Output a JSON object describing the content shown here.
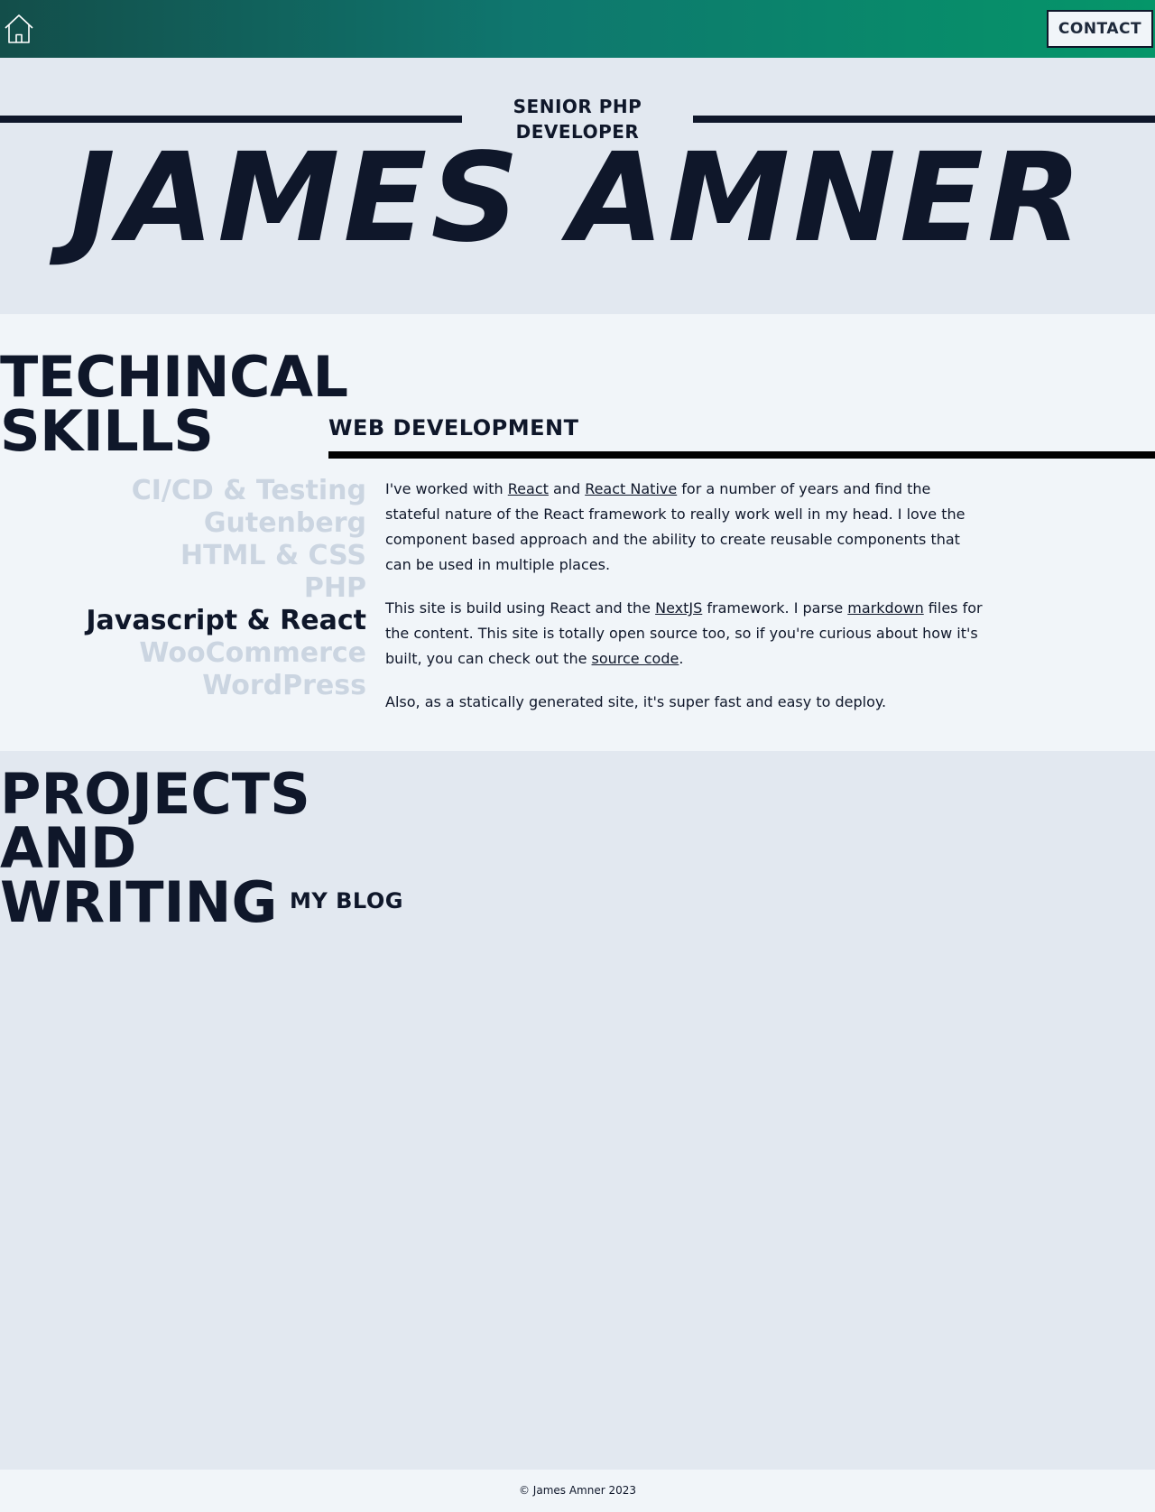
{
  "header": {
    "home_icon": "home-icon",
    "contact_label": "CONTACT",
    "gradient_colors": [
      "#134e4a",
      "#059669"
    ]
  },
  "hero": {
    "subtitle_line1": "SENIOR PHP",
    "subtitle_line2": "DEVELOPER",
    "name": "JAMES AMNER"
  },
  "skills": {
    "title_line1": "TECHINCAL",
    "title_line2": "SKILLS",
    "active_heading": "WEB DEVELOPMENT",
    "items": [
      {
        "label": "CI/CD & Testing",
        "active": false
      },
      {
        "label": "Gutenberg",
        "active": false
      },
      {
        "label": "HTML & CSS",
        "active": false
      },
      {
        "label": "PHP",
        "active": false
      },
      {
        "label": "Javascript & React",
        "active": true
      },
      {
        "label": "WooCommerce",
        "active": false
      },
      {
        "label": "WordPress",
        "active": false
      }
    ],
    "paragraph1": {
      "t1": "I've worked with ",
      "link1": "React",
      "t2": " and ",
      "link2": "React Native",
      "t3": " for a number of years and find the stateful nature of the React framework to really work well in my head. I love the component based approach and the ability to create reusable components that can be used in multiple places."
    },
    "paragraph2": {
      "t1": "This site is build using React and the ",
      "link1": "NextJS",
      "t2": " framework. I parse ",
      "link2": "markdown",
      "t3": " files for the content. This site is totally open source too, so if you're curious about how it's built, you can check out the ",
      "link3": "source code",
      "t4": "."
    },
    "paragraph3": "Also, as a statically generated site, it's super fast and easy to deploy."
  },
  "projects": {
    "title_line1": "PROJECTS",
    "title_line2": "AND",
    "title_line3": "WRITING",
    "blog_heading": "MY BLOG"
  },
  "footer": {
    "copyright": "© James Amner 2023"
  },
  "colors": {
    "text_dark": "#0f172a",
    "skill_inactive": "#cbd5e1",
    "bg_light": "#f1f5f9",
    "bg_mid": "#e2e8f0"
  }
}
